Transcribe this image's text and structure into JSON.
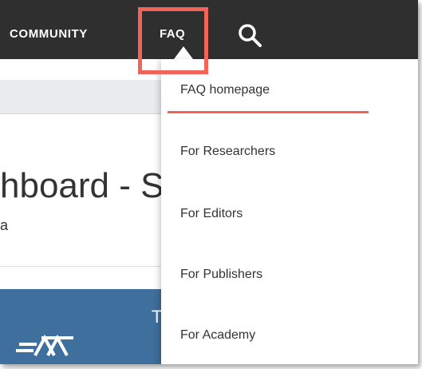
{
  "nav": {
    "community_label": "COMMUNITY",
    "faq_label": "FAQ",
    "search_icon": "search-icon"
  },
  "page": {
    "title_fragment": "hboard - S",
    "subtitle_fragment": "a"
  },
  "dropdown": {
    "items": [
      {
        "label": "FAQ homepage"
      },
      {
        "label": "For Researchers"
      },
      {
        "label": "For Editors"
      },
      {
        "label": "For Publishers"
      },
      {
        "label": "For Academy"
      }
    ]
  },
  "colors": {
    "nav_bg": "#2f2f2f",
    "highlight": "#f2645a",
    "banner": "#3f6f9c"
  }
}
